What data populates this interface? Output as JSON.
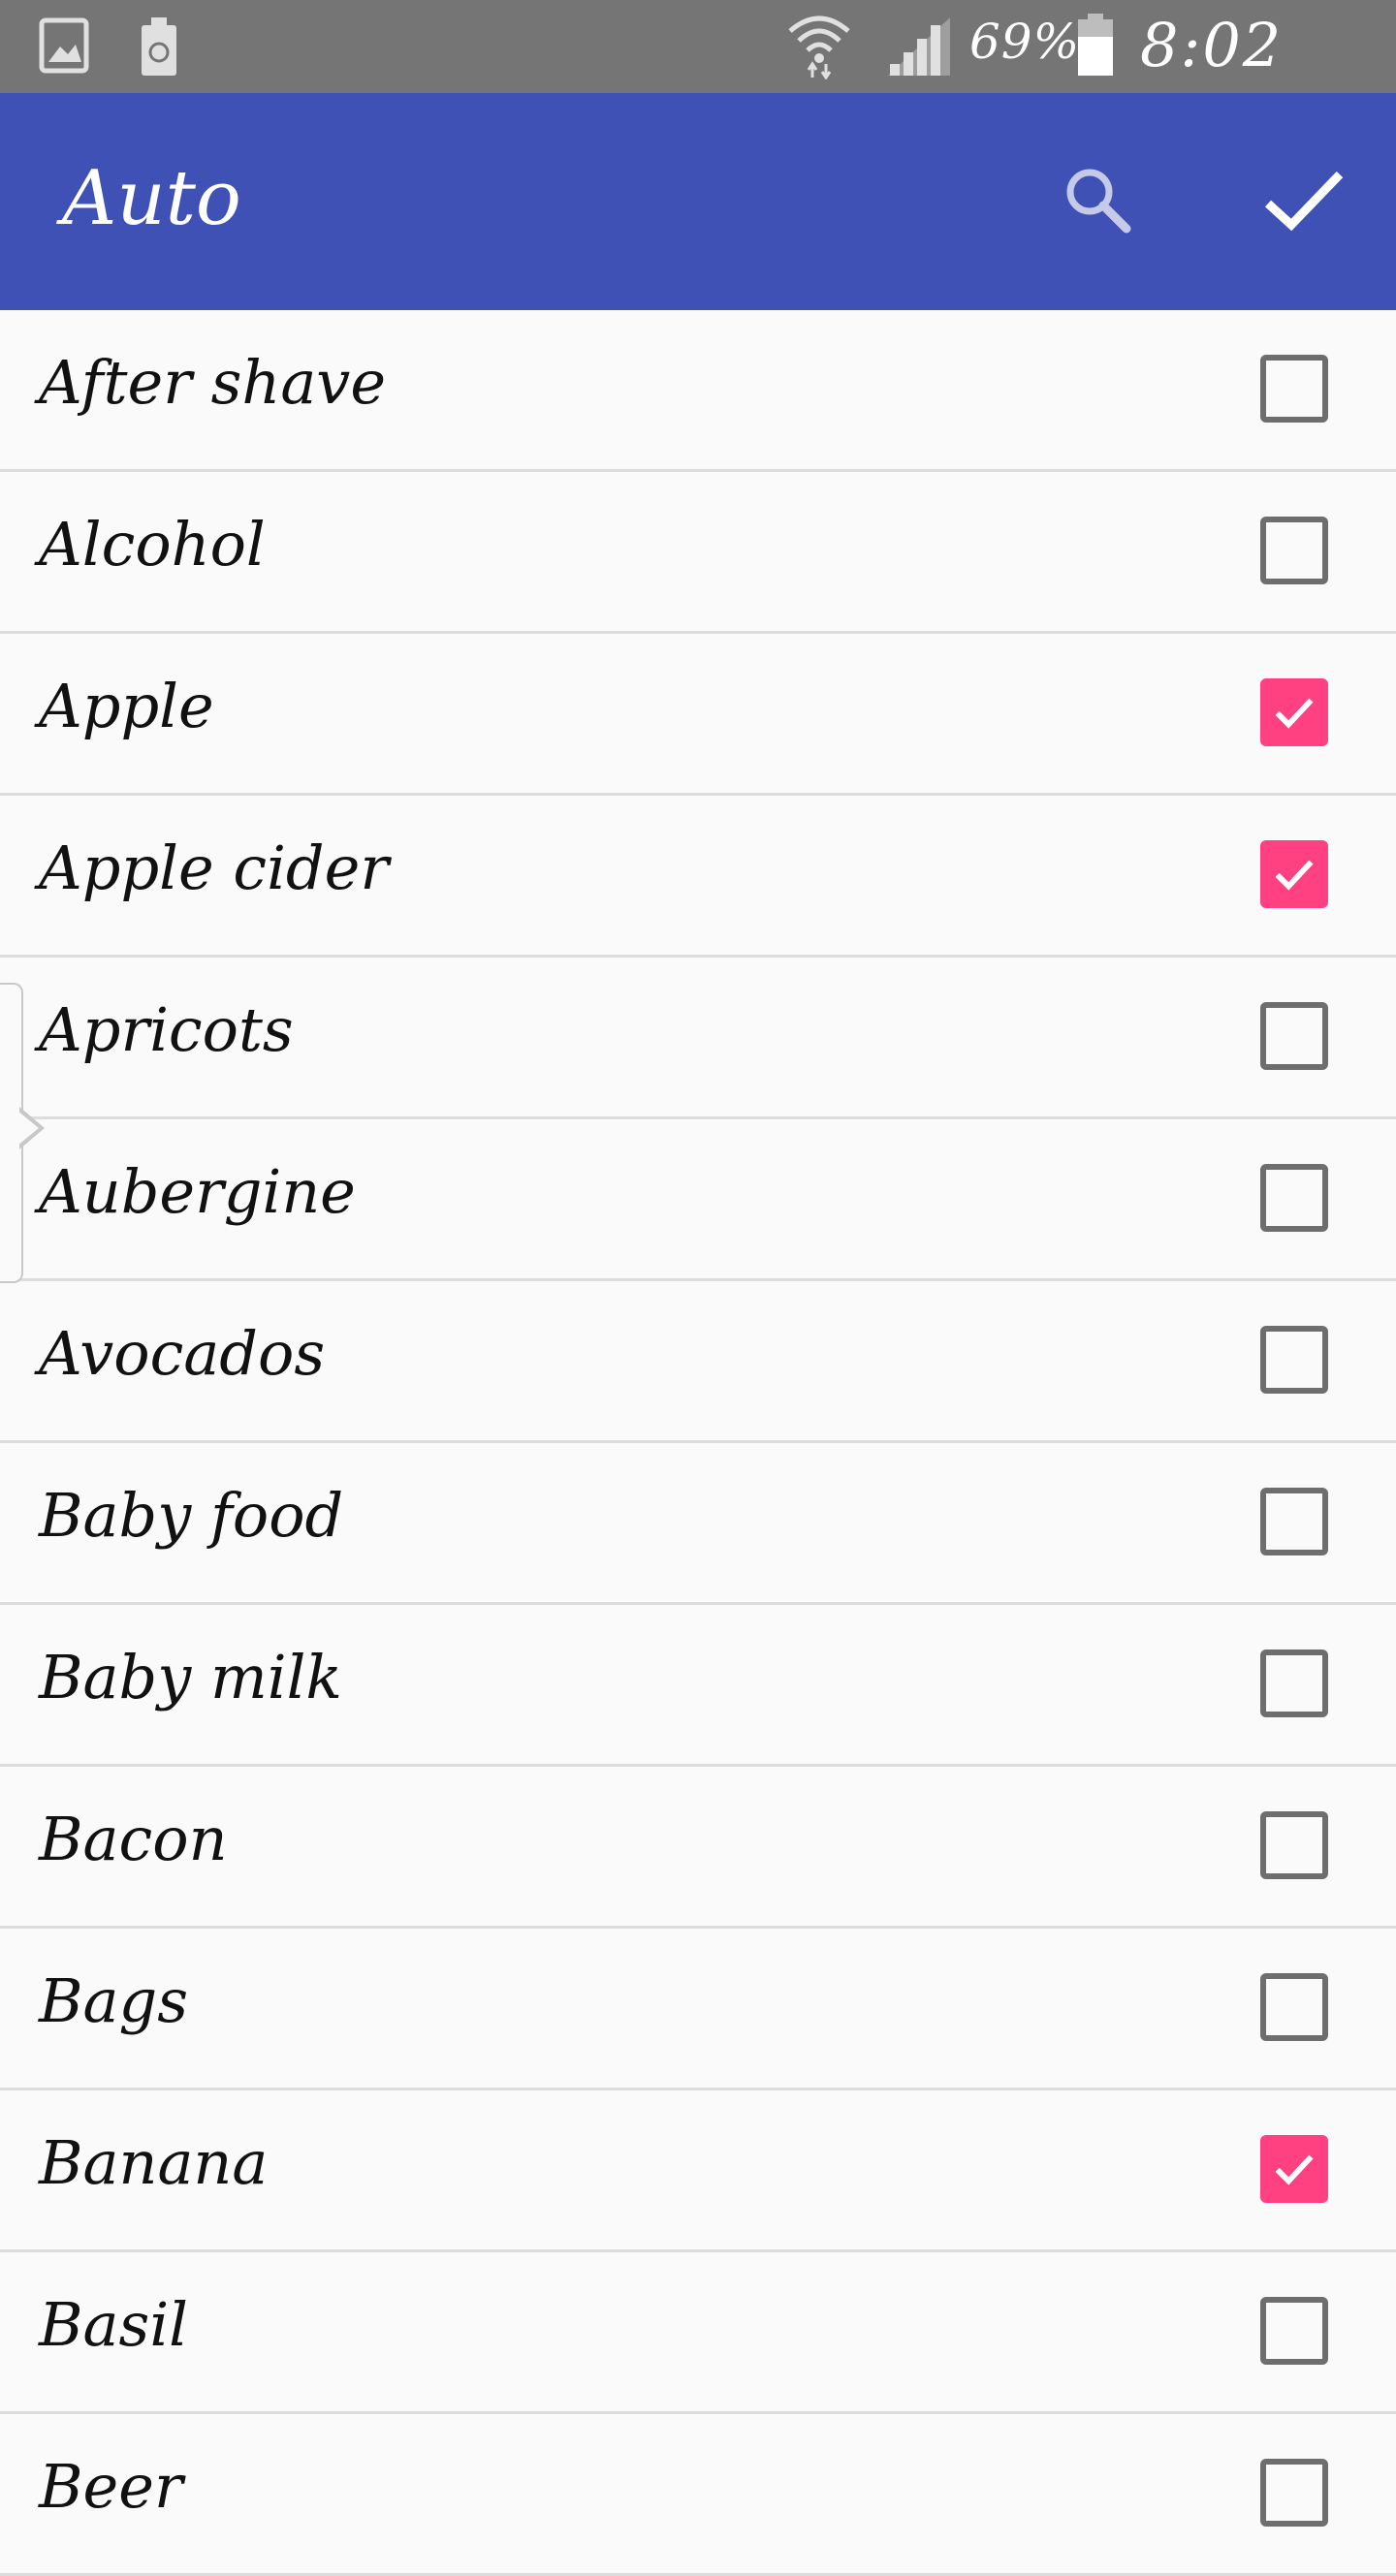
{
  "status_bar": {
    "battery_percent": "69%",
    "time": "8:02 PM",
    "icons": [
      "gallery-icon",
      "recycle-icon",
      "wifi-icon",
      "signal-icon",
      "battery-icon"
    ]
  },
  "app_bar": {
    "title": "Auto",
    "search_icon": "search-icon",
    "done_icon": "check-icon",
    "color": "#3f51b5"
  },
  "accent_color": "#ff4081",
  "items": [
    {
      "label": "After shave",
      "checked": false
    },
    {
      "label": "Alcohol",
      "checked": false
    },
    {
      "label": "Apple",
      "checked": true
    },
    {
      "label": "Apple cider",
      "checked": true
    },
    {
      "label": "Apricots",
      "checked": false
    },
    {
      "label": "Aubergine",
      "checked": false
    },
    {
      "label": "Avocados",
      "checked": false
    },
    {
      "label": "Baby food",
      "checked": false
    },
    {
      "label": "Baby milk",
      "checked": false
    },
    {
      "label": "Bacon",
      "checked": false
    },
    {
      "label": "Bags",
      "checked": false
    },
    {
      "label": "Banana",
      "checked": true
    },
    {
      "label": "Basil",
      "checked": false
    },
    {
      "label": "Beer",
      "checked": false
    }
  ]
}
